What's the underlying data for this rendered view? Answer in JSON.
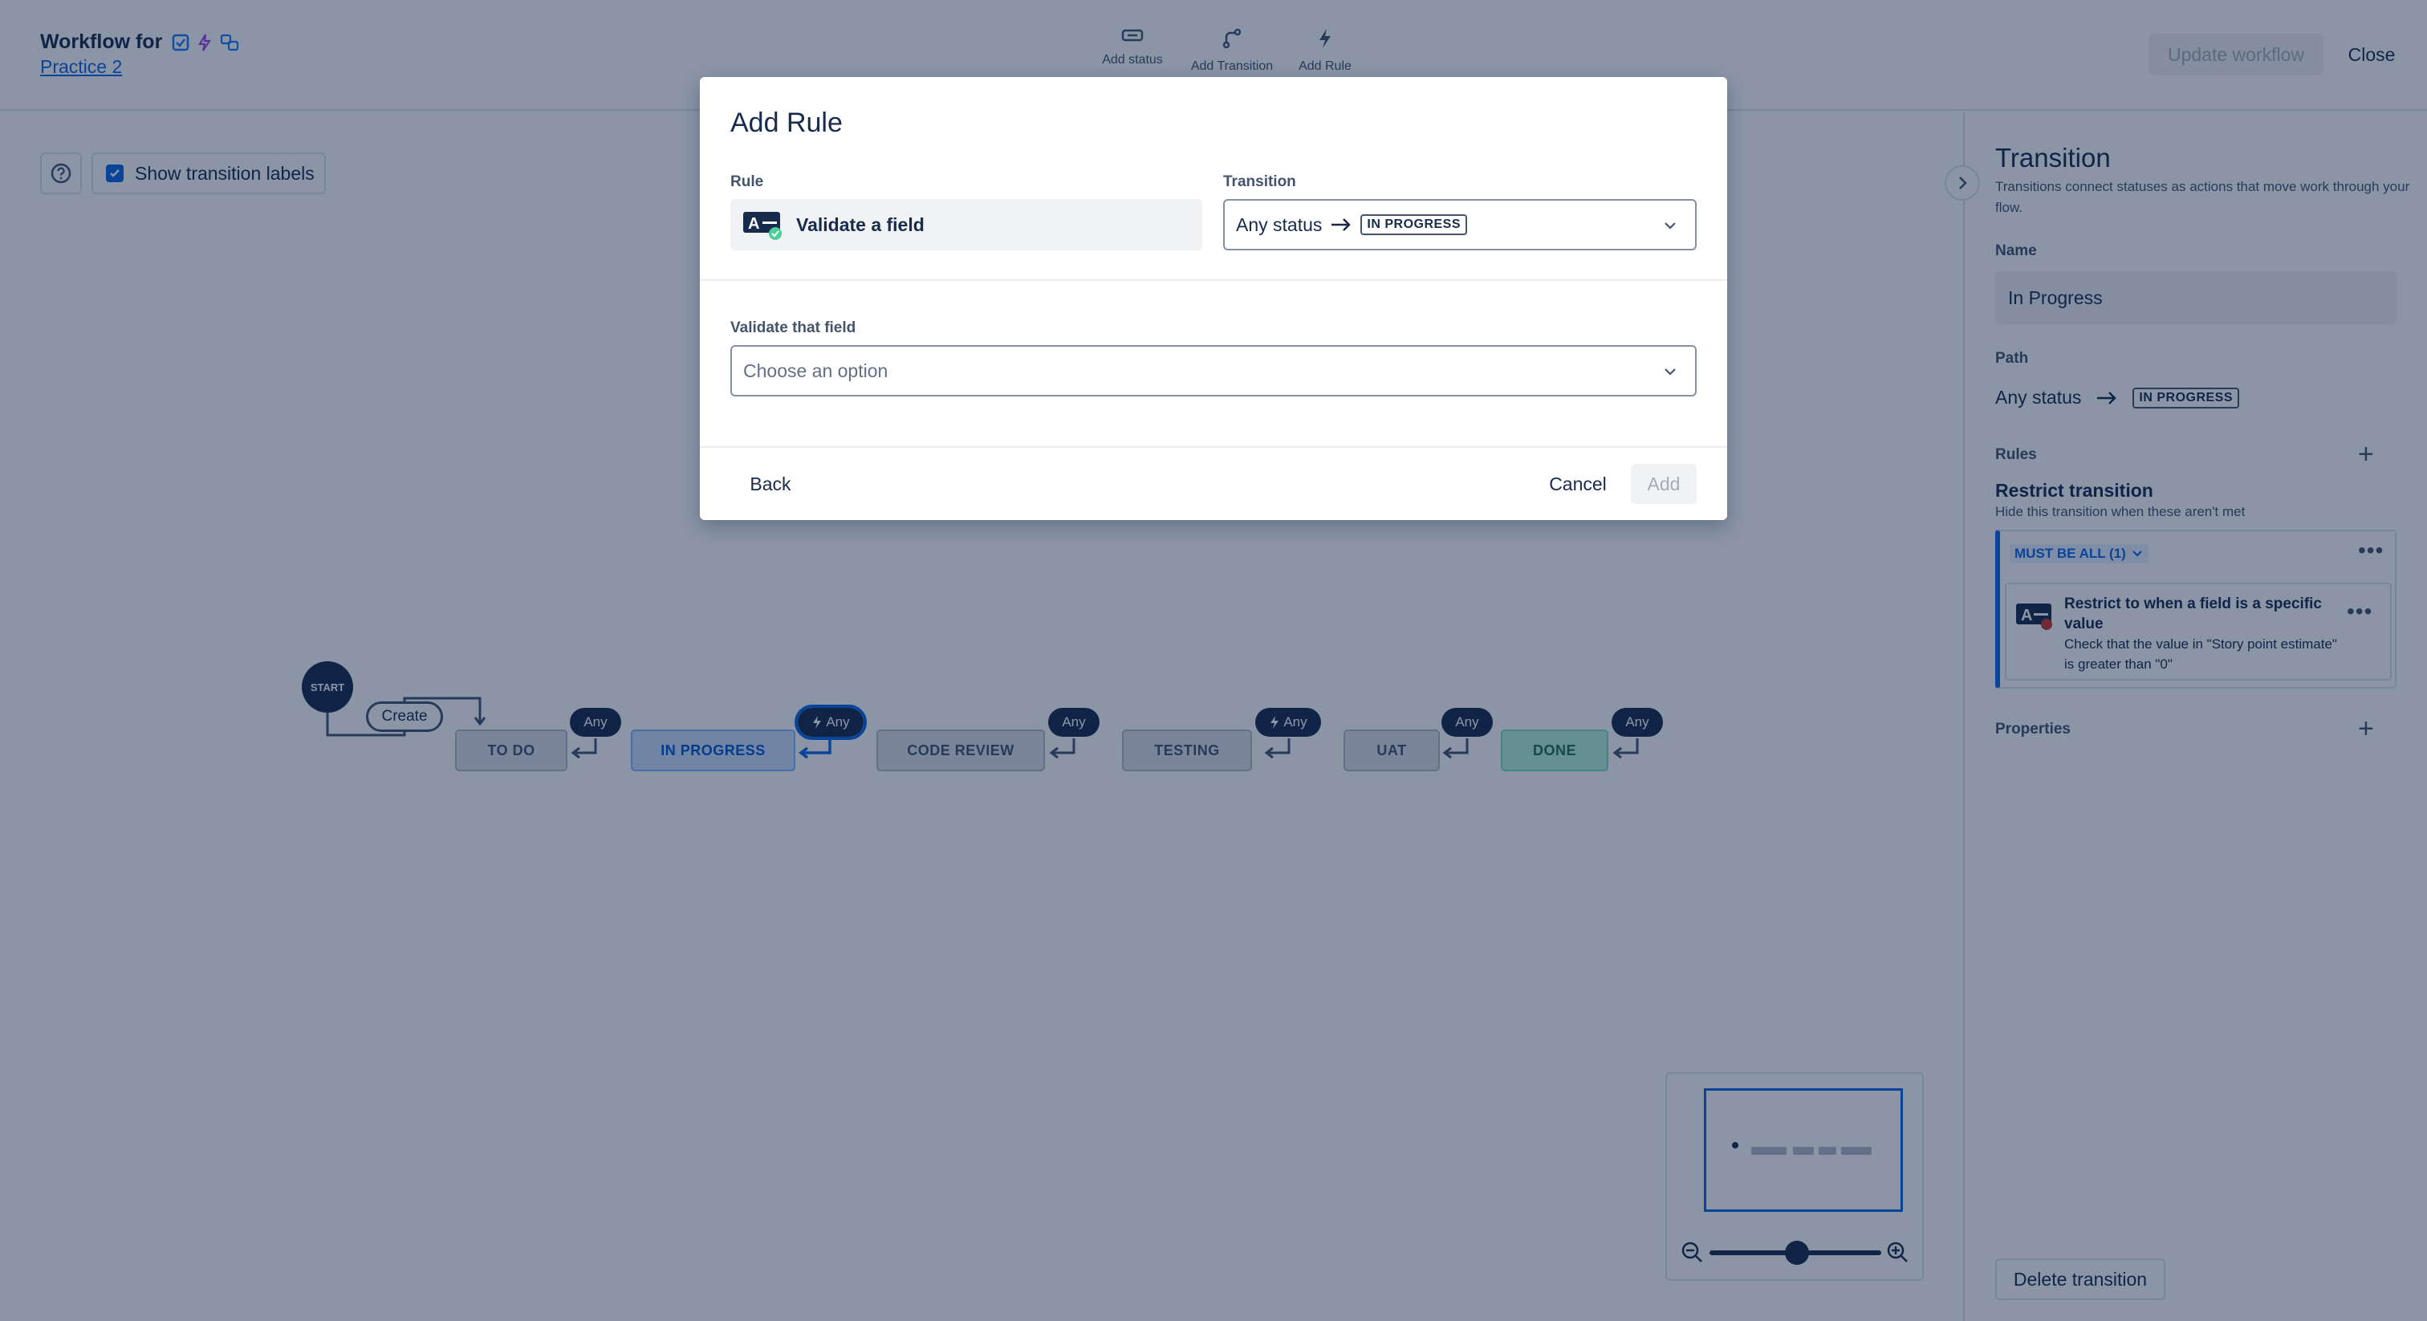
{
  "header": {
    "title_prefix": "Workflow for",
    "project_link": "Practice 2",
    "toolbar": [
      {
        "label": "Add status",
        "icon": "status-icon"
      },
      {
        "label": "Add Transition",
        "icon": "transition-icon"
      },
      {
        "label": "Add Rule",
        "icon": "lightning-icon"
      }
    ],
    "update_label": "Update workflow",
    "close_label": "Close"
  },
  "canvas": {
    "show_labels": "Show transition labels",
    "show_labels_checked": true,
    "start_label": "START",
    "create_label": "Create",
    "statuses": [
      "TO DO",
      "IN PROGRESS",
      "CODE REVIEW",
      "TESTING",
      "UAT",
      "DONE"
    ],
    "any_label": "Any"
  },
  "panel": {
    "title": "Transition",
    "description": "Transitions connect statuses as actions that move work through your flow.",
    "name_label": "Name",
    "name_value": "In Progress",
    "path_label": "Path",
    "path_from": "Any status",
    "path_to": "IN PROGRESS",
    "rules_label": "Rules",
    "restrict_title": "Restrict transition",
    "restrict_desc": "Hide this transition when these aren't met",
    "must_be_all": "MUST BE ALL (1)",
    "rule_title": "Restrict to when a field is a specific value",
    "rule_desc": "Check that the value in \"Story point estimate\" is greater than \"0\"",
    "properties_label": "Properties",
    "delete_label": "Delete transition"
  },
  "modal": {
    "title": "Add Rule",
    "rule_label": "Rule",
    "rule_value": "Validate a field",
    "transition_label": "Transition",
    "transition_from": "Any status",
    "transition_to": "IN PROGRESS",
    "field_label": "Validate that field",
    "field_placeholder": "Choose an option",
    "back_label": "Back",
    "cancel_label": "Cancel",
    "add_label": "Add"
  },
  "colors": {
    "accent": "#0c66e4",
    "overlay": "#091e42",
    "dark": "#172b4d"
  }
}
